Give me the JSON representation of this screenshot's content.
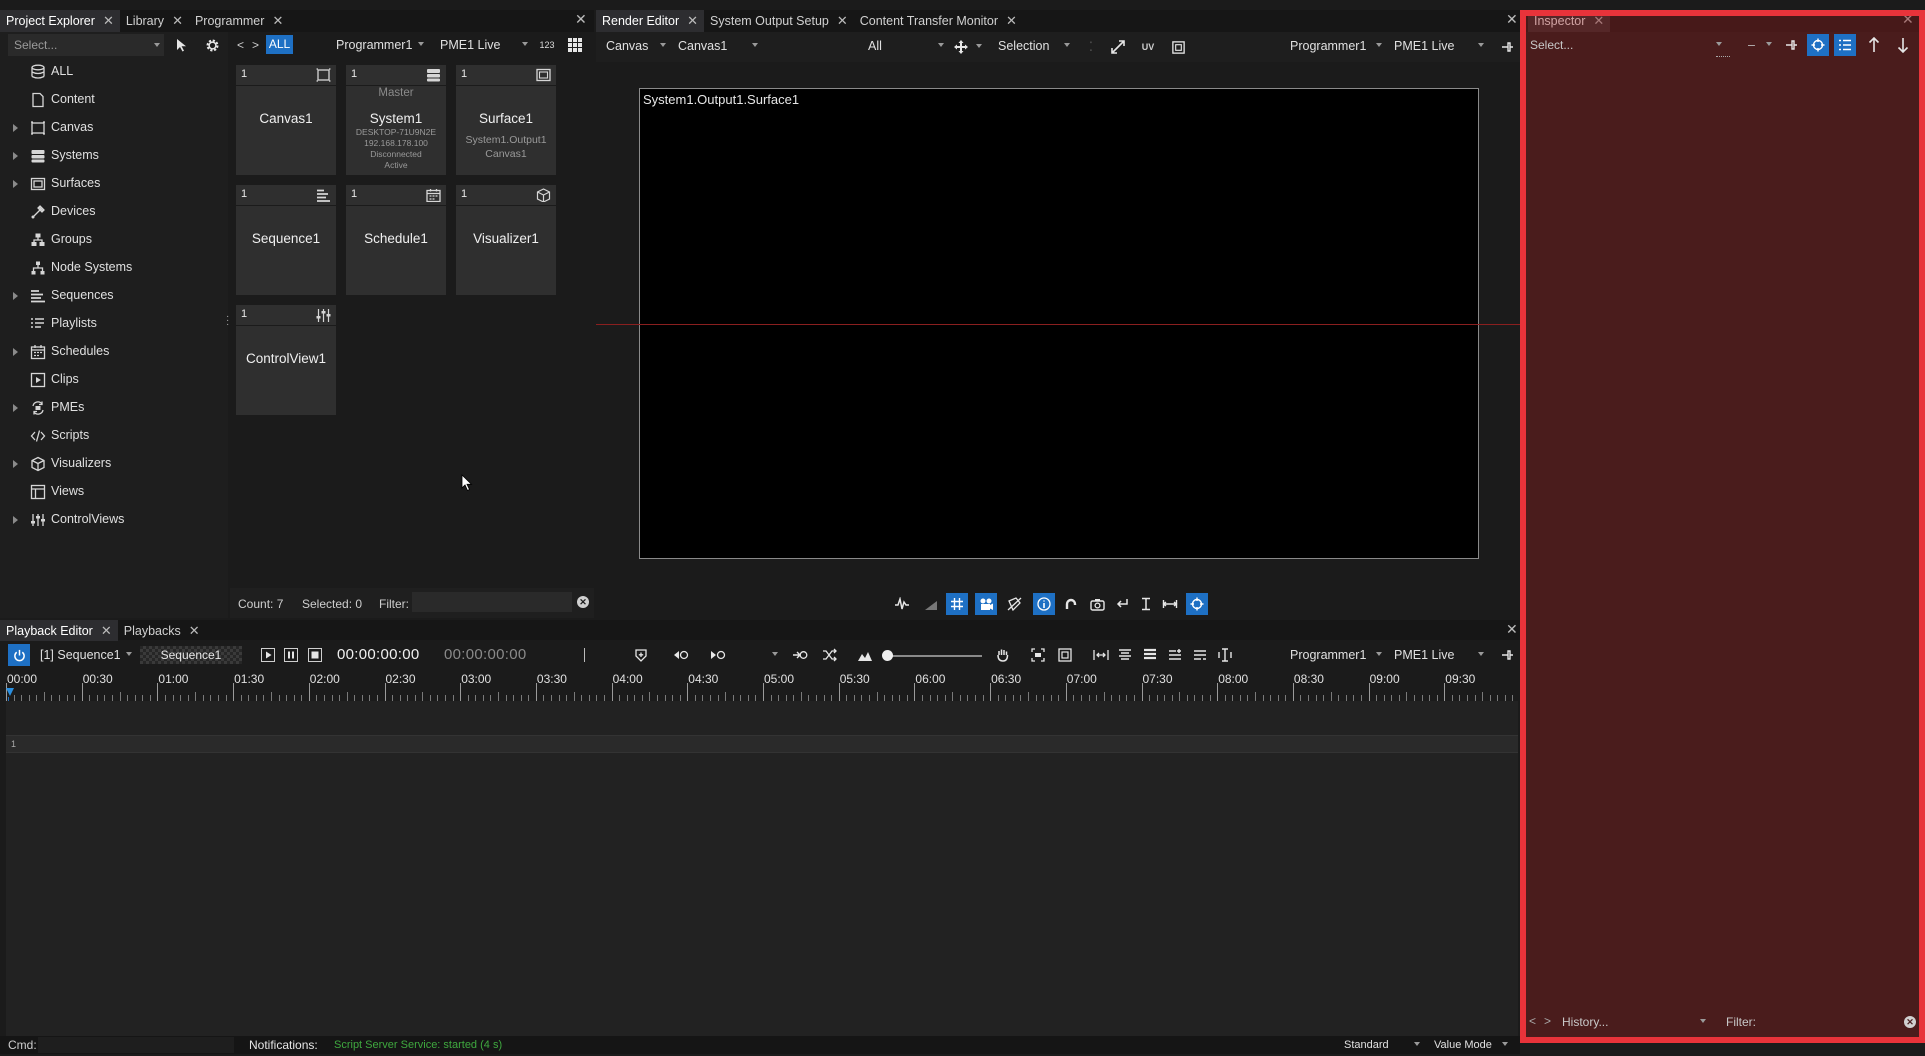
{
  "top_left_tabs": [
    {
      "label": "Project Explorer",
      "active": true
    },
    {
      "label": "Library",
      "active": false
    },
    {
      "label": "Programmer",
      "active": false
    }
  ],
  "top_center_tabs": [
    {
      "label": "Render Editor",
      "active": true
    },
    {
      "label": "System Output Setup",
      "active": false
    },
    {
      "label": "Content Transfer Monitor",
      "active": false
    }
  ],
  "inspector_tab": {
    "label": "Inspector"
  },
  "bottom_tabs": [
    {
      "label": "Playback Editor",
      "active": true
    },
    {
      "label": "Playbacks",
      "active": false
    }
  ],
  "explorer": {
    "select_placeholder": "Select...",
    "tree": [
      {
        "label": "ALL",
        "icon": "database-icon",
        "expandable": false
      },
      {
        "label": "Content",
        "icon": "content-icon",
        "expandable": false
      },
      {
        "label": "Canvas",
        "icon": "canvas-icon",
        "expandable": true
      },
      {
        "label": "Systems",
        "icon": "systems-icon",
        "expandable": true
      },
      {
        "label": "Surfaces",
        "icon": "surfaces-icon",
        "expandable": true
      },
      {
        "label": "Devices",
        "icon": "devices-icon",
        "expandable": false
      },
      {
        "label": "Groups",
        "icon": "groups-icon",
        "expandable": false
      },
      {
        "label": "Node Systems",
        "icon": "node-systems-icon",
        "expandable": false
      },
      {
        "label": "Sequences",
        "icon": "sequences-icon",
        "expandable": true
      },
      {
        "label": "Playlists",
        "icon": "playlists-icon",
        "expandable": false
      },
      {
        "label": "Schedules",
        "icon": "schedules-icon",
        "expandable": true
      },
      {
        "label": "Clips",
        "icon": "clips-icon",
        "expandable": false
      },
      {
        "label": "PMEs",
        "icon": "pmes-icon",
        "expandable": true
      },
      {
        "label": "Scripts",
        "icon": "scripts-icon",
        "expandable": false
      },
      {
        "label": "Visualizers",
        "icon": "visualizers-icon",
        "expandable": true
      },
      {
        "label": "Views",
        "icon": "views-icon",
        "expandable": false
      },
      {
        "label": "ControlViews",
        "icon": "controlviews-icon",
        "expandable": true
      }
    ]
  },
  "pool": {
    "nav_back": "<",
    "nav_fwd": ">",
    "all_label": "ALL",
    "programmer": "Programmer1",
    "pme": "PME1 Live",
    "numbers_toggle": "123",
    "tiles": [
      {
        "num": "1",
        "name": "Canvas1",
        "icon": "canvas-icon",
        "master": "",
        "sub": []
      },
      {
        "num": "1",
        "name": "System1",
        "icon": "system-server-icon",
        "master": "Master",
        "sub": [
          "DESKTOP-71U9N2E",
          "192.168.178.100",
          "Disconnected",
          "Active"
        ]
      },
      {
        "num": "1",
        "name": "Surface1",
        "icon": "surface-icon",
        "master": "",
        "sub": [
          "System1.Output1",
          "Canvas1"
        ]
      },
      {
        "num": "1",
        "name": "Sequence1",
        "icon": "sequence-icon",
        "master": "",
        "sub": []
      },
      {
        "num": "1",
        "name": "Schedule1",
        "icon": "schedule-icon",
        "master": "",
        "sub": []
      },
      {
        "num": "1",
        "name": "Visualizer1",
        "icon": "visualizer-icon",
        "master": "",
        "sub": []
      },
      {
        "num": "1",
        "name": "ControlView1",
        "icon": "controlview-icon",
        "master": "",
        "sub": []
      }
    ],
    "footer": {
      "count": "Count: 7",
      "selected": "Selected: 0",
      "filter_label": "Filter:"
    }
  },
  "render_editor": {
    "mode": "Canvas",
    "canvas": "Canvas1",
    "layer_filter": "All",
    "tool": "Selection",
    "programmer": "Programmer1",
    "pme": "PME1 Live",
    "surface_label": "System1.Output1.Surface1"
  },
  "playback": {
    "sequence_dropdown": "[1] Sequence1",
    "sequence_chip": "Sequence1",
    "timecode": "00:00:00:00",
    "timecode2": "00:00:00:00",
    "programmer": "Programmer1",
    "pme": "PME1 Live",
    "timeline_labels": [
      "00:00",
      "00:30",
      "01:00",
      "01:30",
      "02:00",
      "02:30",
      "03:00",
      "03:30",
      "04:00",
      "04:30",
      "05:00",
      "05:30",
      "06:00",
      "06:30",
      "07:00",
      "07:30",
      "08:00",
      "08:30",
      "09:00",
      "09:30"
    ],
    "track_number": "1"
  },
  "inspector": {
    "select_placeholder": "Select...",
    "dash": "–",
    "history_placeholder": "History...",
    "filter_label": "Filter:",
    "nav_back": "<",
    "nav_fwd": ">"
  },
  "status_bar": {
    "cmd_label": "Cmd:",
    "notifications_label": "Notifications:",
    "notification_text": "Script Server Service: started (4 s)",
    "layout_mode": "Standard",
    "value_mode": "Value Mode"
  },
  "colors": {
    "accent_blue": "#1e70c4",
    "inspector_border": "#e8333a",
    "inspector_fill": "#4a1f20",
    "notification_green": "#3fa83f"
  }
}
